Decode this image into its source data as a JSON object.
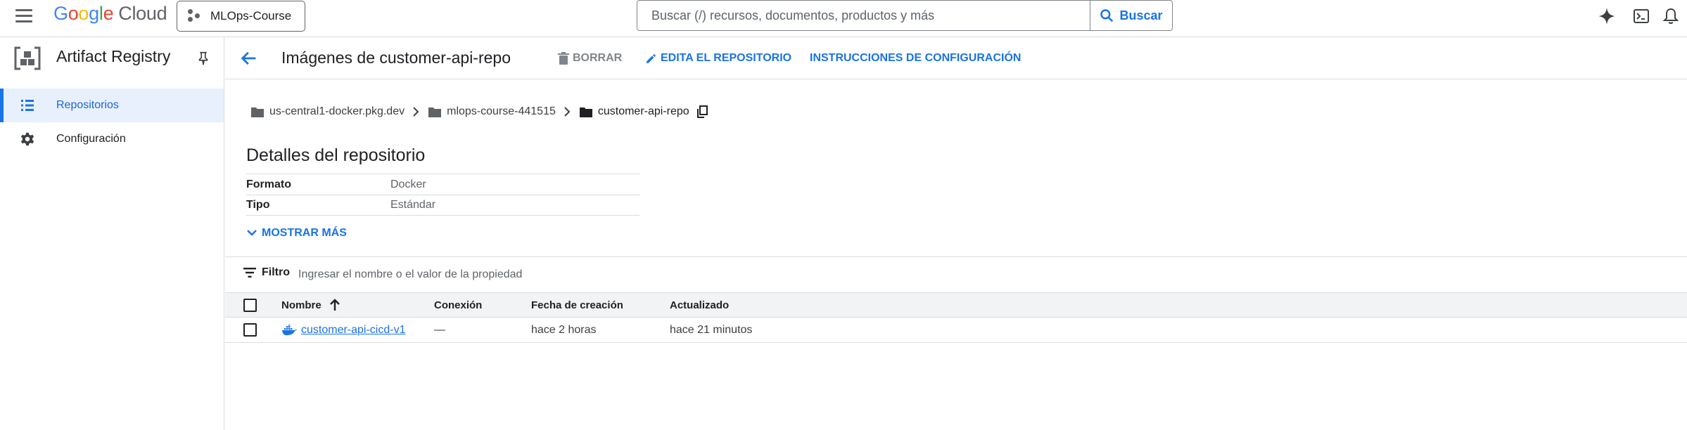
{
  "topbar": {
    "logo_google": "Google",
    "logo_cloud": "Cloud",
    "project": "MLOps-Course",
    "search_placeholder": "Buscar (/) recursos, documentos, productos y más",
    "search_button": "Buscar"
  },
  "sidebar": {
    "product_title": "Artifact Registry",
    "items": [
      {
        "label": "Repositorios",
        "icon": "list-icon",
        "active": true
      },
      {
        "label": "Configuración",
        "icon": "gear-icon",
        "active": false
      }
    ]
  },
  "header": {
    "title": "Imágenes de customer-api-repo",
    "actions": {
      "delete": "BORRAR",
      "edit": "EDITA EL REPOSITORIO",
      "setup": "INSTRUCCIONES DE CONFIGURACIÓN"
    }
  },
  "breadcrumb": [
    "us-central1-docker.pkg.dev",
    "mlops-course-441515",
    "customer-api-repo"
  ],
  "details": {
    "title": "Detalles del repositorio",
    "rows": [
      {
        "key": "Formato",
        "value": "Docker"
      },
      {
        "key": "Tipo",
        "value": "Estándar"
      }
    ],
    "show_more": "MOSTRAR MÁS"
  },
  "filter": {
    "label": "Filtro",
    "placeholder": "Ingresar el nombre o el valor de la propiedad"
  },
  "table": {
    "columns": [
      "Nombre",
      "Conexión",
      "Fecha de creación",
      "Actualizado"
    ],
    "rows": [
      {
        "name": "customer-api-cicd-v1",
        "connection": "—",
        "created": "hace 2 horas",
        "updated": "hace 21 minutos"
      }
    ]
  },
  "colors": {
    "accent": "#1a73e8",
    "active_bg": "#e8f0fe",
    "border": "#dadce0"
  }
}
